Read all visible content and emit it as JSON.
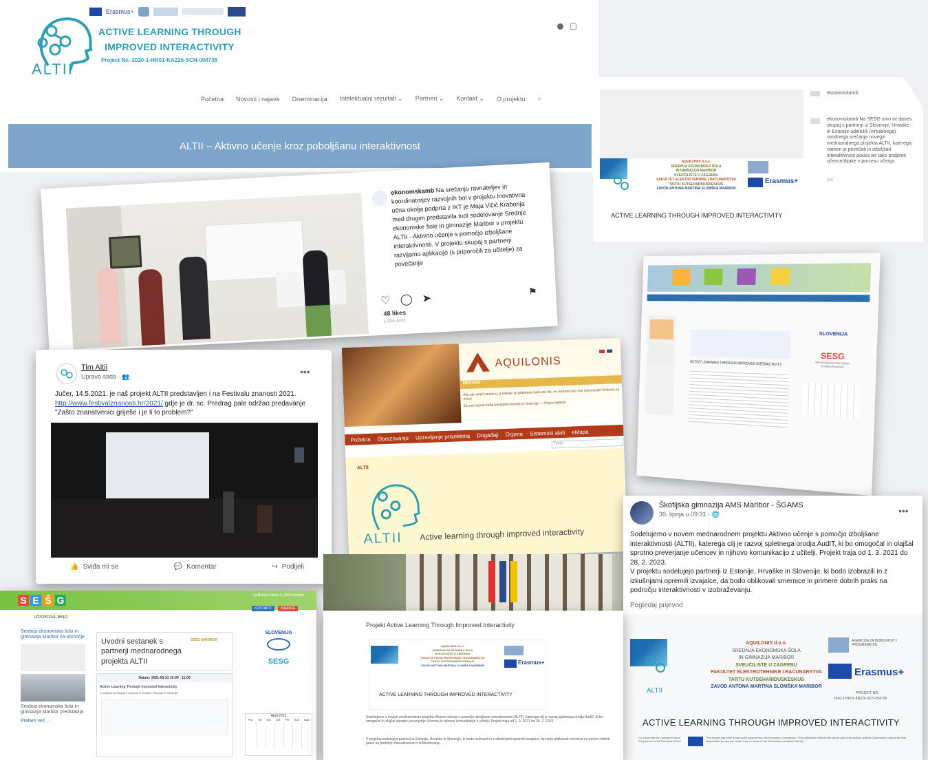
{
  "header": {
    "logo_brand": "ALTII",
    "title_line1": "ACTIVE LEARNING THROUGH",
    "title_line2": "IMPROVED INTERACTIVITY",
    "project_no": "Project No. 2020-1-HR01-KA226-SCH-094735",
    "erasmus_small": "Erasmus+",
    "nav": [
      "Početna",
      "Novosti i najave",
      "Diseminacija",
      "Intelektualni rezultati",
      "Partneri",
      "Kontakt",
      "O projektu"
    ],
    "banner": "ALTII – Aktivno učenje kroz poboljšanu interaktivnost"
  },
  "instagram_post": {
    "account": "ekonomskamb",
    "text": "Na srečanju ravnateljev in koordinatorjev razvojnih bol v projektu Inovativna učna okolja podprta z IKT je Maja Vičič Krabonja med drugim predstavila tudi sodelovanje Srednje ekonomske šole in gimnazije Maribor v projektu ALTII - Aktivno učenje s pomočjo izboljšane interaktivnosti. V projektu skupaj s partnerji razvijamo aplikacijo (s priporočili za učitelje) za povečanje",
    "likes": "48 likes",
    "age": "1 DAY AGO"
  },
  "instagram_card_right": {
    "account": "ekonomskamb",
    "text": "ekonomskamb Na SEŠG smo se danes skupaj s partnerji iz Slovenije, Hrvaške in Estonije udeležili (virtualnega) uvodnega srečanja novega mednarodnega projekta ALTII, katerega namen je povečati in izboljšati interaktivnost pouka ter tako podpreti učence/dijake v procesu učenja.",
    "age": "2w",
    "caption": "ACTIVE LEARNING THROUGH IMPROVED INTERACTIVITY"
  },
  "partner_logos": {
    "line1": "AQUILONIS d.o.o.",
    "line2": "SREDNJA EKONOMSKA ŠOLA",
    "line3": "IN GIMNAZIJA MARIBOR",
    "line4": "SVEUČILIŠTE U ZAGREBU",
    "line5": "FAKULTET ELEKTROTEHNIKE I RAČUNARSTVA",
    "line6": "TARTU KUTSEHARIDUSKESKUS",
    "line7": "ZAVOD ANTONA MARTINA SLOMŠKA MARIBOR",
    "erasmus": "Erasmus+",
    "project_no_label": "PROJECT NO.",
    "project_no": "2020-1-HR01-KA226-SCH-094735",
    "caption": "ACTIVE LEARNING THROUGH IMPROVED INTERACTIVITY",
    "agency": "AGENCIJA ZA MOBILNOST I PROGRAME EU"
  },
  "fb_post_1": {
    "author": "Tim Altii",
    "time": "Upravo sada",
    "text_1": "Jučer, 14.5.2021. je naš projekt ALTII predstavljen i na Festivalu znanosti 2021.",
    "link": "http://www.festivalznanosti.hr/2021/",
    "text_2": " gdje je dr. sc. Predrag pale održao predavanje",
    "text_3": "\"Zašto znanstvenici griješe i je li to problem?\"",
    "actions": [
      "Sviđa mi se",
      "Komentar",
      "Podijeli"
    ]
  },
  "aquilonis": {
    "brand": "AQUILONIS",
    "novosti": "Novosti",
    "ticker": "Ako ste vidjeli stranicu, a kasnije se pobrinete kako ste bili, ne možete naći sve informacije? Kliknite na mreži",
    "ticker2": "Za sve kojima treba besplatan kontakt iz financija — Prijava tijekom",
    "nav": [
      "Početna",
      "Obrazovanje",
      "Upravljanje projektima",
      "Događaji",
      "Ocjene",
      "Sistemski alati",
      "eMapa"
    ],
    "search_placeholder": "Traži",
    "section_label": "ALTII",
    "logo_brand": "ALTII",
    "tagline": "Active learning through improved interactivity"
  },
  "sesg_right": {
    "slovenija": "SLOVENIJA",
    "sesg": "SESG",
    "caption": "ACTIVE LEARNING THROUGH IMPROVED INTERACTIVITY",
    "side_note": "ŠPORTNIKOM PRIJAZNO IZOBRAŽEVANJE"
  },
  "fb_post_2": {
    "author": "Škofijska gimnazija AMS Maribor - ŠGAMS",
    "time": "30. lipnja u 09:31 · ",
    "text": "Sodelujemo v novem mednarodnem projektu Aktivno učenje s pomočjo izboljšane interaktivnosti (ALTII), katerega cilj je razvoj spletnega orodja AudIT, ki bo omogočal in olajšal sprotno preverjanje učencev in njihovo komunikacijo z učitelji. Projekt traja od 1. 3. 2021 do 28. 2. 2023.\nV projektu sodelujejo partnerji iz Estonije, Hrvaške in Slovenije, ki bodo izobrazili in z izkušnjami opremili izvajalce, da bodo oblikovali smernice in primere dobrih praks na področju interaktivnosti v izobraževanju.",
    "see_translation": "Pogledaj prijevod",
    "footer_note": "This project has been funded with support from the European Commission. This publication reflects the views only of the author, and the Commission cannot be held responsible for any use which may be made of the information contained therein.",
    "cofunded": "Co-funded by the Creative Europe Programme of the European Union"
  },
  "sesg_bottom": {
    "sesg": "SESG",
    "izpostavljeno": "IZPOSTAVLJENO",
    "kontakti": "KONTAKTI",
    "iskanje": "ISKANJE",
    "post_title": "Uvodni sestanek s partnerji mednarodnega projekta ALTII",
    "tag": "SEŠG MARIBOR",
    "datum": "Datum: 2021-03-31 10:00 - 11:00",
    "article_title": "Active Learning Through Improved Interactivity",
    "article_line": "V projektu sodelujejo s partnerji iz Hrvaške, Estonije in Slovenije",
    "slovenija": "SLOVENIJA",
    "calendar_month": "April 2021",
    "calendar_days": [
      "Pon",
      "Tor",
      "Sre",
      "Čet",
      "Pet",
      "Sob",
      "Ned"
    ],
    "side_items": [
      "Srednja ekonomska šola in gimnazija Maribor predstavlja",
      "Srednja ekonomska šola in gimnazija Maribor za območje"
    ],
    "preberi": "Preberi več →",
    "address": "Trg Borisa Kidriča 3, 2000 Maribor"
  },
  "middle_bottom": {
    "project_title": "Projekt Active Learning Through Improved Interactivity",
    "text": "Sodelujemo v novem mednarodnem projektu Aktivno učenje s pomočjo izboljšane interaktivnosti (ALTII), katerega cilj je razvoj spletnega orodja AudIT, ki bo omogočal in olajšal sprotno preverjanje učencev in njihovo komunikacijo z učitelji. Projekt traja od 1. 3. 2021 do 28. 2. 2023.",
    "text2": "V projektu sodelujejo partnerji iz Estonije, Hrvaške in Slovenije, ki bodo izobrazili in z izkušnjami opremili izvajalce, da bodo oblikovali smernice in primere dobrih praks na področju interaktivnosti v izobraževanju."
  },
  "colors": {
    "teal": "#2aa0b8",
    "banner": "#7ea6cd",
    "erasmus_blue": "#1b4aa8",
    "aquilonis_red": "#b13a18",
    "sesg_green": "#7ac143"
  }
}
